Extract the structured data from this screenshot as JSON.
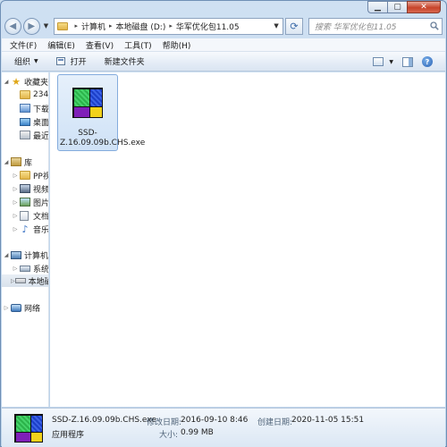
{
  "window": {
    "breadcrumb": [
      "计算机",
      "本地磁盘 (D:)",
      "华军优化包11.05"
    ],
    "search_placeholder": "搜索 华军优化包11.05"
  },
  "menu": [
    "文件(F)",
    "编辑(E)",
    "查看(V)",
    "工具(T)",
    "帮助(H)"
  ],
  "toolbar": {
    "organize_label": "组织",
    "open_label": "打开",
    "new_folder_label": "新建文件夹"
  },
  "nav_tree": {
    "favorites": "收藏夹",
    "fav_items": [
      "234",
      "下载",
      "桌面",
      "最近访问的位置"
    ],
    "libraries": "库",
    "lib_items": [
      "PP视频",
      "视频",
      "图片",
      "文档",
      "音乐"
    ],
    "computer": "计算机",
    "comp_items": [
      "系统 (C:)",
      "本地磁盘 (D:)"
    ],
    "network": "网络"
  },
  "files": [
    {
      "name": "SSD-Z.16.09.09b.CHS.exe",
      "icon": "ssd-z-app-icon"
    }
  ],
  "details": {
    "filename": "SSD-Z.16.09.09b.CHS.exe",
    "type": "应用程序",
    "modified_label": "修改日期:",
    "modified_value": "2016-09-10 8:46",
    "created_label": "创建日期:",
    "created_value": "2020-11-05 15:51",
    "size_label": "大小:",
    "size_value": "0.99 MB"
  },
  "colors": {
    "selection": "#cfe2f6",
    "chrome": "#c9dcef"
  }
}
